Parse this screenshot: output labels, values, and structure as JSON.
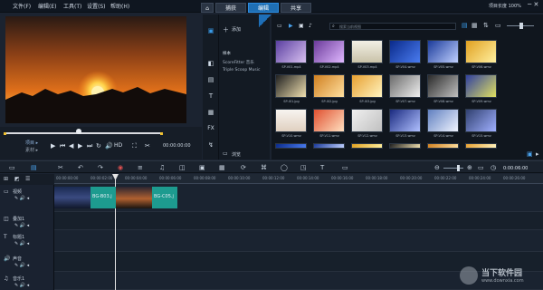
{
  "titlebar": {
    "menus": [
      "文件(F)",
      "编辑(E)",
      "工具(T)",
      "设置(S)",
      "帮助(H)"
    ],
    "tabs": [
      {
        "label": "捕获"
      },
      {
        "label": "编辑"
      },
      {
        "label": "共享"
      }
    ],
    "active_tab": 1,
    "project_info": "项目长度 100%"
  },
  "player": {
    "mode_project": "项目 ▸",
    "mode_clip": "素材 ▸",
    "hd": "HD",
    "timecode": "00:00:00:00"
  },
  "library": {
    "add_label": "添加",
    "search_placeholder": "搜索当前视图",
    "folders": [
      "样本",
      "ScoreFitter 音乐",
      "Triple Scoop Music"
    ],
    "browse_label": "浏览",
    "thumb_labels": [
      "SP-V01.mp4",
      "SP-V02.mp4",
      "SP-V03.mp4",
      "SP-V04.wmv",
      "SP-V05.wmv",
      "SP-V06.wmv",
      "SP-I01.jpg",
      "SP-I02.jpg",
      "SP-I03.jpg",
      "SP-V07.wmv",
      "SP-V08.wmv",
      "SP-V09.wmv",
      "SP-V10.wmv",
      "SP-V11.wmv",
      "SP-V12.wmv",
      "SP-V13.wmv",
      "SP-V14.wmv",
      "SP-V15.wmv"
    ]
  },
  "timeline": {
    "timecode": "0:00:06:00",
    "tracks": [
      "视频",
      "叠加1",
      "标题1",
      "声音",
      "音乐1"
    ],
    "clips": [
      {
        "label": "BG-B03.j"
      },
      {
        "label": "BG-C05.j"
      }
    ]
  },
  "watermark": {
    "title": "当下软件园",
    "url": "www.downxia.com"
  }
}
